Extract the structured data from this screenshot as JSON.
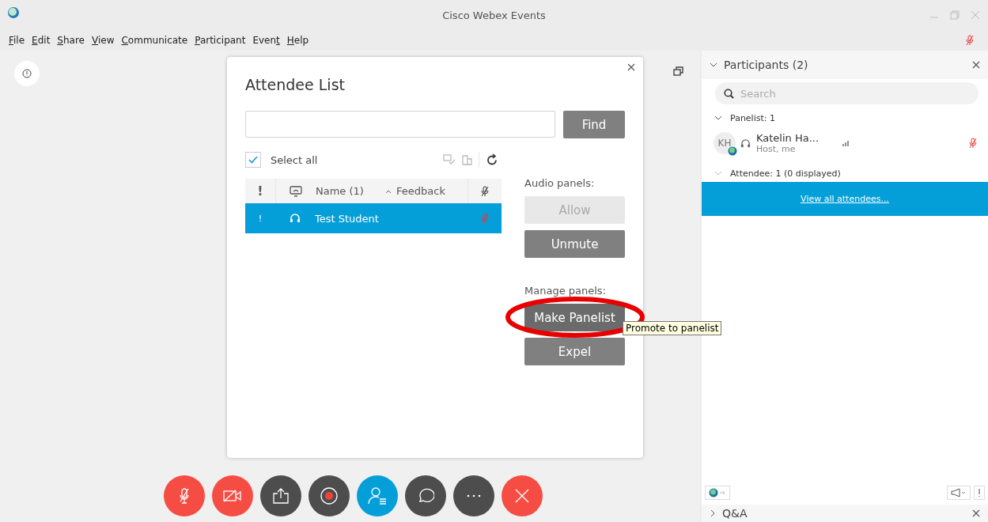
{
  "window": {
    "title": "Cisco Webex Events"
  },
  "menu": [
    {
      "segments": [
        {
          "text": "F",
          "underlined": true
        },
        {
          "text": "ile",
          "underlined": false
        }
      ]
    },
    {
      "segments": [
        {
          "text": "E",
          "underlined": true
        },
        {
          "text": "dit",
          "underlined": false
        }
      ]
    },
    {
      "segments": [
        {
          "text": "S",
          "underlined": true
        },
        {
          "text": "hare",
          "underlined": false
        }
      ]
    },
    {
      "segments": [
        {
          "text": "V",
          "underlined": true
        },
        {
          "text": "iew",
          "underlined": false
        }
      ]
    },
    {
      "segments": [
        {
          "text": "C",
          "underlined": true
        },
        {
          "text": "ommunicate",
          "underlined": false
        }
      ]
    },
    {
      "segments": [
        {
          "text": "P",
          "underlined": true
        },
        {
          "text": "articipant",
          "underlined": false
        }
      ]
    },
    {
      "segments": [
        {
          "text": "Even",
          "underlined": false
        },
        {
          "text": "t",
          "underlined": true
        }
      ]
    },
    {
      "segments": [
        {
          "text": "H",
          "underlined": true
        },
        {
          "text": "elp",
          "underlined": false
        }
      ]
    }
  ],
  "dialog": {
    "title": "Attendee List",
    "find_button": "Find",
    "select_all": {
      "label": "Select all",
      "checked": true
    },
    "table": {
      "columns": [
        {
          "label": "!",
          "kind": "text"
        },
        {
          "kind": "monitor"
        },
        {
          "label": "Name (1)",
          "kind": "text"
        },
        {
          "label": "Feedback",
          "kind": "sort"
        },
        {
          "kind": "mic"
        }
      ],
      "rows": [
        {
          "flag": "!",
          "name": "Test Student",
          "selected": true
        }
      ]
    },
    "audio_label": "Audio panels:",
    "audio_buttons": [
      {
        "label": "Allow",
        "disabled": true
      },
      {
        "label": "Unmute",
        "disabled": false
      }
    ],
    "manage_label": "Manage panels:",
    "manage_buttons": [
      {
        "label": "Make Panelist",
        "highlighted": true
      },
      {
        "label": "Expel",
        "highlighted": false
      }
    ],
    "tooltip": "Promote to panelist"
  },
  "participants": {
    "title": "Participants (2)",
    "search_placeholder": "Search",
    "groups": [
      {
        "label": "Panelist: 1",
        "expanded": true,
        "members": [
          {
            "initials": "KH",
            "name": "Katelin Ha...",
            "role": "Host, me"
          }
        ]
      },
      {
        "label": "Attendee: 1 (0 displayed)",
        "expanded": true
      }
    ],
    "view_all_link": "View all attendees..."
  },
  "qa_panel": {
    "title": "Q&A",
    "expanded": false
  }
}
